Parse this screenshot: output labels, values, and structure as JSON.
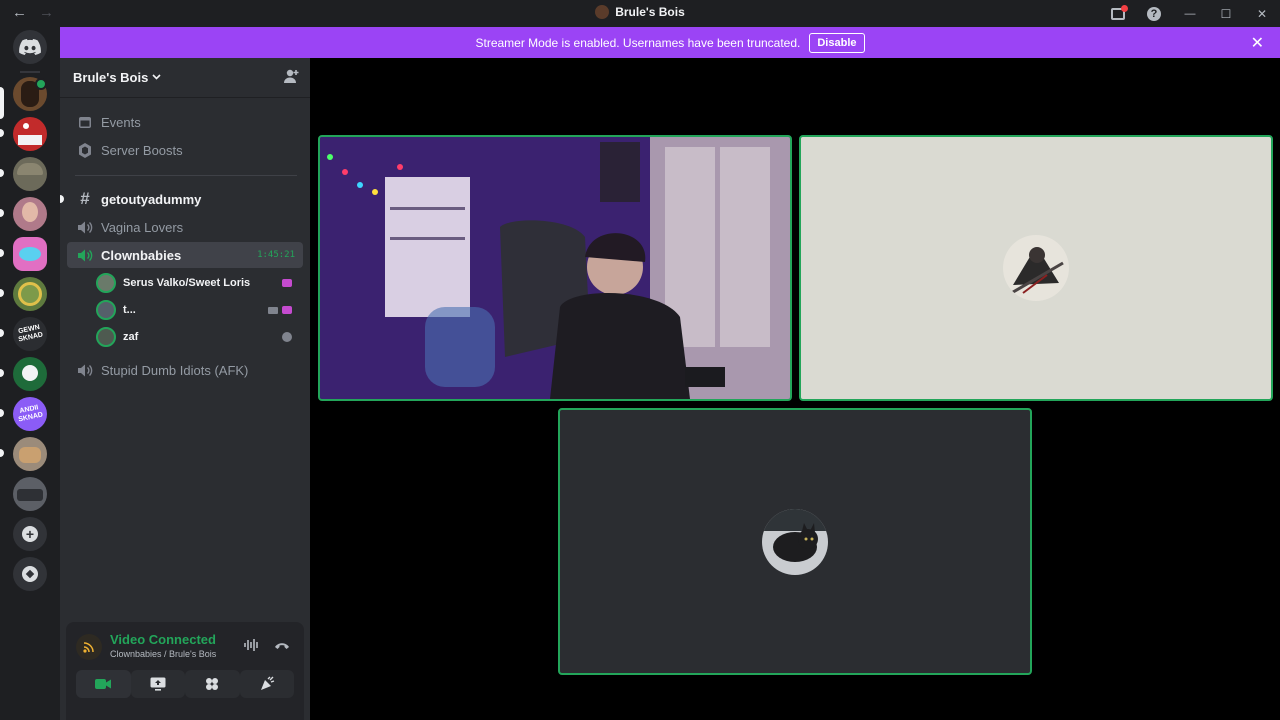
{
  "window": {
    "title": "Brule's Bois",
    "back": "←",
    "forward": "→",
    "help": "?",
    "minimize": "—",
    "maximize": "☐",
    "close": "✕"
  },
  "banner": {
    "text": "Streamer Mode is enabled. Usernames have been truncated.",
    "disable_label": "Disable",
    "close": "✕"
  },
  "rail": {
    "add_server": "+",
    "servers": [
      {
        "icon": "server-avatar",
        "color": "#6b4a2e"
      },
      {
        "icon": "mushroom",
        "color": "#c22b2b"
      },
      {
        "icon": "soldier",
        "color": "#6c6a5a"
      },
      {
        "icon": "portrait",
        "color": "#b07a8a"
      },
      {
        "icon": "pink-creature",
        "color": "#e16fc3"
      },
      {
        "icon": "frog",
        "color": "#5e7a3e"
      },
      {
        "icon": "gewn-sknad",
        "color": "#2b2d31",
        "text": "GEWN SKNAD"
      },
      {
        "icon": "green-crest",
        "color": "#1e6b3a"
      },
      {
        "icon": "andii-sknad",
        "color": "#8b5cf6",
        "text": "ANDII SKNAD"
      },
      {
        "icon": "cat-photo",
        "color": "#9b8b7a"
      },
      {
        "icon": "truck",
        "color": "#5c5f66"
      }
    ]
  },
  "sidebar": {
    "guild_name": "Brule's Bois",
    "items": [
      {
        "label": "Events",
        "icon": "calendar"
      },
      {
        "label": "Server Boosts",
        "icon": "boost"
      }
    ],
    "channels": [
      {
        "label": "getoutyadummy",
        "type": "text",
        "unread": true
      },
      {
        "label": "Vagina Lovers",
        "type": "voice"
      },
      {
        "label": "Clownbabies",
        "type": "voice",
        "active": true,
        "timer": "1:45:21"
      },
      {
        "label": "Stupid Dumb Idiots (AFK)",
        "type": "voice"
      }
    ],
    "voice_users": [
      {
        "name": "Serus Valko/Sweet Loris",
        "live": true
      },
      {
        "name": "t...",
        "camera": true,
        "live": true
      },
      {
        "name": "zaf",
        "ghost": true
      }
    ]
  },
  "voice_panel": {
    "status": "Video Connected",
    "location": "Clownbabies / Brule's Bois"
  },
  "colors": {
    "accent_green": "#23a55a",
    "streamer_purple": "#9b44f5"
  }
}
